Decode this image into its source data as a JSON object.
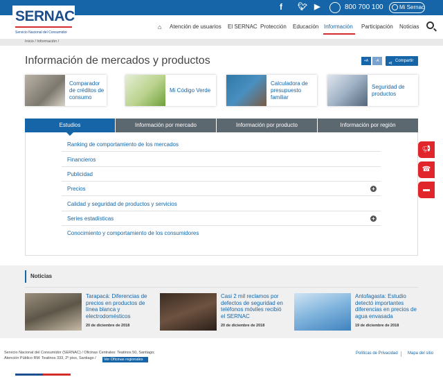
{
  "topbar": {
    "phone": "800 700 100",
    "account_label": "Mi Sernac",
    "social": [
      "facebook-icon",
      "twitter-icon",
      "youtube-icon"
    ]
  },
  "header": {
    "logo_name": "SERNAC",
    "logo_sub": "Servicio Nacional del Consumidor",
    "nav": [
      "Atención de usuarios",
      "El SERNAC",
      "Protección",
      "Educación",
      "Información",
      "Participación",
      "Noticias"
    ],
    "active_nav": "Información"
  },
  "breadcrumb": "Inicio / Información /",
  "page": {
    "title": "Información de mercados y productos",
    "font_plus": "+A",
    "font_minus": "-A",
    "share": "Compartir"
  },
  "cards": [
    {
      "label": "Comparador de créditos de consumo"
    },
    {
      "label": "Mi Código Verde"
    },
    {
      "label": "Calculadora de presupuesto familiar"
    },
    {
      "label": "Seguridad de productos"
    }
  ],
  "tabs": [
    "Estudios",
    "Información por mercado",
    "Información por producto",
    "Información por región"
  ],
  "active_tab": "Estudios",
  "studies": [
    {
      "label": "Ranking de comportamiento de los mercados",
      "expandable": false
    },
    {
      "label": "Financieros",
      "expandable": false
    },
    {
      "label": "Publicidad",
      "expandable": false
    },
    {
      "label": "Precios",
      "expandable": true
    },
    {
      "label": "Calidad y seguridad de productos y servicios",
      "expandable": false
    },
    {
      "label": "Series estadísticas",
      "expandable": true
    },
    {
      "label": "Conocimiento y comportamiento de los consumidores",
      "expandable": false
    }
  ],
  "news": {
    "heading": "Noticias",
    "items": [
      {
        "title": "Tarapacá: Diferencias de precios en productos de línea blanca y electrodomésticos",
        "date": "20 de diciembre de 2018"
      },
      {
        "title": "Casi 2 mil reclamos por defectos de seguridad en teléfonos móviles recibió el SERNAC",
        "date": "20 de diciembre de 2018"
      },
      {
        "title": "Antofagasta: Estudio detectó importantes diferencias en precios de agua envasada",
        "date": "19 de diciembre de 2018"
      }
    ]
  },
  "footer": {
    "line1": "Servicio Nacional del Consumidor (SERNAC) / Oficinas Centrales: Teatinos 50, Santiago;",
    "line2": "Atención Público RM: Teatinos 333, 2º piso, Santiago /",
    "regional_button": "Ver Oficinas regionales",
    "privacy": "Políticas de Privacidad",
    "sitemap": "Mapa del sitio"
  },
  "colors": {
    "primary": "#1565a8",
    "accent_red": "#e0262b",
    "tab_inactive": "#5c6870"
  }
}
